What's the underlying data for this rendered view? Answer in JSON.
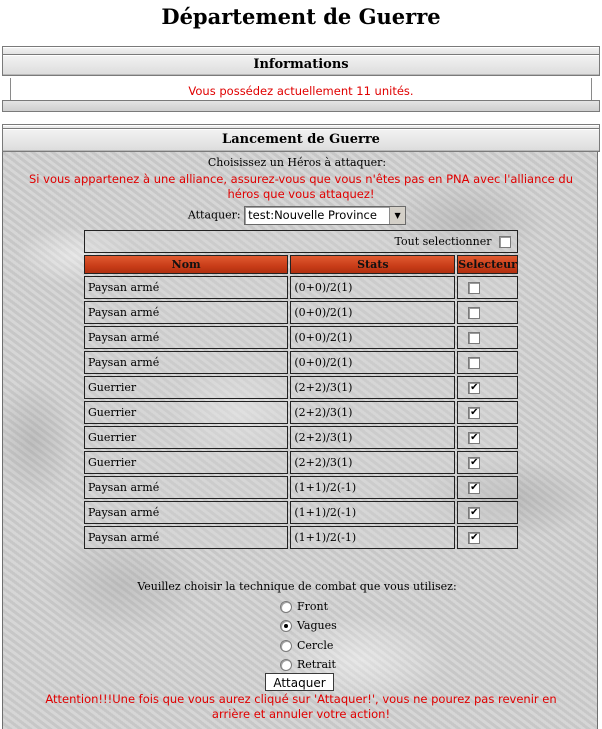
{
  "page_title": "Département de Guerre",
  "info": {
    "title": "Informations",
    "message": "Vous possédez actuellement 11 unités."
  },
  "war": {
    "title": "Lancement de Guerre",
    "choose_hero": "Choisissez un Héros à attaquer:",
    "alliance_warning": "Si vous appartenez à une alliance, assurez-vous que vous n'êtes pas en PNA avec l'alliance du héros que vous attaquez!",
    "attack_label": "Attaquer:",
    "target_value": "test:Nouvelle Province",
    "select_all_label": "Tout selectionner",
    "select_all_checked": false,
    "columns": [
      "Nom",
      "Stats",
      "Selecteur"
    ],
    "units": [
      {
        "name": "Paysan armé",
        "stats": "(0+0)/2(1)",
        "checked": false
      },
      {
        "name": "Paysan armé",
        "stats": "(0+0)/2(1)",
        "checked": false
      },
      {
        "name": "Paysan armé",
        "stats": "(0+0)/2(1)",
        "checked": false
      },
      {
        "name": "Paysan armé",
        "stats": "(0+0)/2(1)",
        "checked": false
      },
      {
        "name": "Guerrier",
        "stats": "(2+2)/3(1)",
        "checked": true
      },
      {
        "name": "Guerrier",
        "stats": "(2+2)/3(1)",
        "checked": true
      },
      {
        "name": "Guerrier",
        "stats": "(2+2)/3(1)",
        "checked": true
      },
      {
        "name": "Guerrier",
        "stats": "(2+2)/3(1)",
        "checked": true
      },
      {
        "name": "Paysan armé",
        "stats": "(1+1)/2(-1)",
        "checked": true
      },
      {
        "name": "Paysan armé",
        "stats": "(1+1)/2(-1)",
        "checked": true
      },
      {
        "name": "Paysan armé",
        "stats": "(1+1)/2(-1)",
        "checked": true
      }
    ],
    "technique_prompt": "Veuillez choisir la technique de combat que vous utilisez:",
    "techniques": [
      {
        "label": "Front",
        "selected": false
      },
      {
        "label": "Vagues",
        "selected": true
      },
      {
        "label": "Cercle",
        "selected": false
      },
      {
        "label": "Retrait",
        "selected": false
      }
    ],
    "attack_button": "Attaquer",
    "final_warning": "Attention!!!Une fois que vous aurez cliqué sur 'Attaquer!', vous ne pourez pas revenir en arrière et annuler votre action!"
  },
  "colors": {
    "warning_red": "#e00000",
    "header_orange": "#c83c18",
    "panel_grey": "#d2d2d2"
  }
}
